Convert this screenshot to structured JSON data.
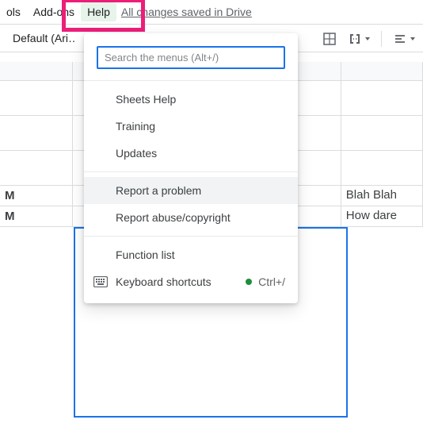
{
  "menubar": {
    "items": [
      "ols",
      "Add-ons",
      "Help"
    ],
    "save_status": "All changes saved in Drive"
  },
  "toolbar": {
    "font": "Default (Ari…"
  },
  "help_menu": {
    "search_placeholder": "Search the menus (Alt+/)",
    "items": [
      {
        "label": "Sheets Help"
      },
      {
        "label": "Training"
      },
      {
        "label": "Updates"
      },
      {
        "sep": true
      },
      {
        "label": "Report a problem",
        "hover": true
      },
      {
        "label": "Report abuse/copyright"
      },
      {
        "sep": true
      },
      {
        "label": "Function list"
      },
      {
        "label": "Keyboard shortcuts",
        "icon": "keyboard",
        "dot": true,
        "shortcut": "Ctrl+/"
      }
    ]
  },
  "cells": {
    "b5": "M",
    "b6": "M",
    "d5": "Blah Blah",
    "d6": "How dare"
  },
  "layout": {
    "colA_w": 94,
    "colB_w": 171,
    "colC_w": 174,
    "colD_w": 105
  }
}
